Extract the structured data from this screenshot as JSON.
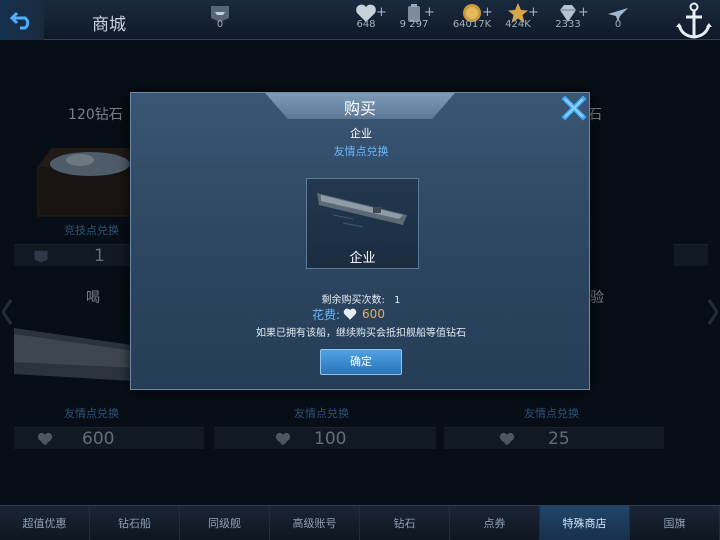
{
  "topbar": {
    "title": "商城",
    "resources": [
      {
        "icon": "fleet-icon",
        "value": "0",
        "has_plus": false
      },
      {
        "icon": "heart-icon",
        "value": "648",
        "has_plus": true
      },
      {
        "icon": "oil-icon",
        "value": "9 297",
        "has_plus": true
      },
      {
        "icon": "coin-icon",
        "value": "64017K",
        "has_plus": true
      },
      {
        "icon": "star-icon",
        "value": "424K",
        "has_plus": true
      },
      {
        "icon": "diamond-icon",
        "value": "2333",
        "has_plus": true
      },
      {
        "icon": "plane-icon",
        "value": "0",
        "has_plus": false
      }
    ]
  },
  "shop": {
    "cards": [
      {
        "title": "120钻石",
        "sub": "竞技点兑换",
        "price": "1"
      },
      {
        "title": "喝",
        "sub": "友情点兑换",
        "price": "600"
      },
      {
        "title": "",
        "sub": "友情点兑换",
        "price": "100"
      },
      {
        "title": "验",
        "sub": "友情点兑换",
        "price": "25"
      }
    ],
    "partial_right_text": "石"
  },
  "tabs": [
    {
      "label": "超值优惠",
      "active": false
    },
    {
      "label": "钻石船",
      "active": false
    },
    {
      "label": "同级舰",
      "active": false
    },
    {
      "label": "高级账号",
      "active": false
    },
    {
      "label": "钻石",
      "active": false
    },
    {
      "label": "点券",
      "active": false
    },
    {
      "label": "特殊商店",
      "active": true
    },
    {
      "label": "国旗",
      "active": false
    }
  ],
  "dialog": {
    "title": "购买",
    "ship_name": "企业",
    "exchange_type": "友情点兑换",
    "ship_caption": "企业",
    "remaining_label": "剩余购买次数:",
    "remaining_value": "1",
    "cost_label": "花费:",
    "cost_value": "600",
    "note": "如果已拥有该船，继续购买会抵扣舰船等值钻石",
    "confirm_label": "确定"
  },
  "colors": {
    "accent_blue": "#69b7ff",
    "cost_gold": "#e0b16a",
    "active_tab": "#20466d"
  }
}
